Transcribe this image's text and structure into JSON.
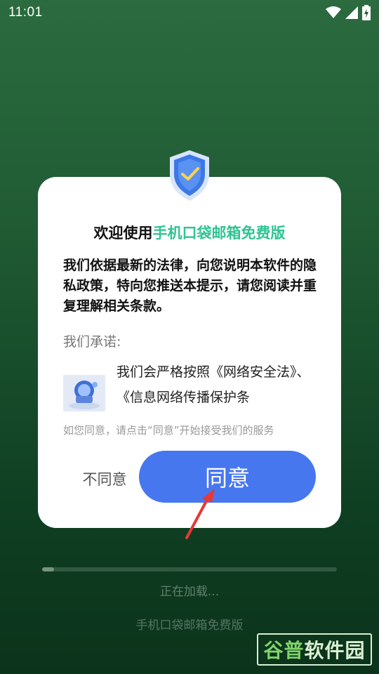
{
  "status_bar": {
    "time": "11:01",
    "icons": [
      "wifi-icon",
      "signal-icon",
      "battery-charging-icon"
    ]
  },
  "dialog": {
    "title_prefix": "欢迎使用",
    "title_app_name": "手机口袋邮箱免费版",
    "intro": "我们依据最新的法律，向您说明本软件的隐私政策，特向您推送本提示，请您阅读并重复理解相关条款。",
    "promise_label": "我们承诺:",
    "promise_text": "我们会严格按照《网络安全法》、《信息网络传播保护条",
    "hint": "如您同意，请点击“同意”开始接受我们的服务",
    "disagree_label": "不同意",
    "agree_label": "同意",
    "accent_color": "#2fc48f",
    "button_color": "#4677ef"
  },
  "loading": {
    "progress": 0.04,
    "text": "正在加载...",
    "app_name": "手机口袋邮箱免费版"
  },
  "watermark": {
    "part1": "谷普",
    "part2": "软件园"
  }
}
